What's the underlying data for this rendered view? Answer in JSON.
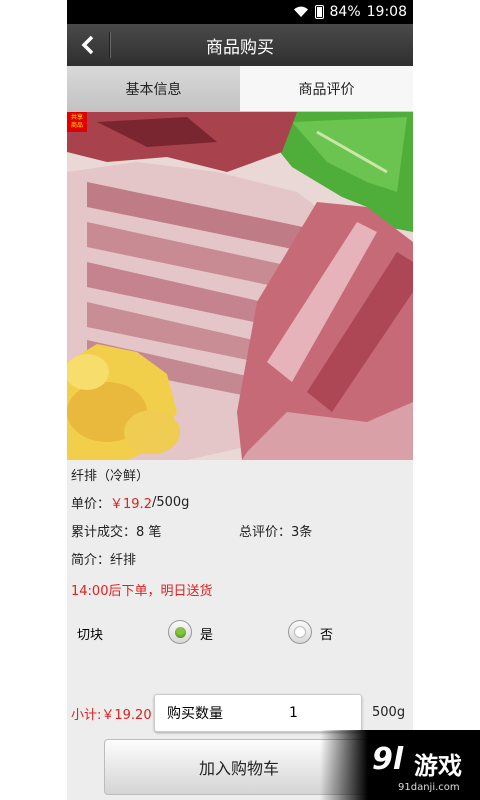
{
  "status": {
    "battery": "84%",
    "time": "19:08"
  },
  "header": {
    "title": "商品购买"
  },
  "tabs": [
    {
      "label": "基本信息"
    },
    {
      "label": "商品评价"
    }
  ],
  "badge": {
    "line1": "共享",
    "line2": "商品"
  },
  "product": {
    "name": "纤排（冷鲜）",
    "price_label": "单价：",
    "price_value": "￥19.2",
    "price_unit": "/500g",
    "sales_label": "累计成交：8 笔",
    "rating_label": "总评价：3条",
    "intro": "简介：纤排",
    "delivery_note": "14:00后下单，明日送货"
  },
  "options": {
    "label": "切块",
    "yes": "是",
    "no": "否",
    "selected": "是"
  },
  "purchase": {
    "subtotal": "小计:￥19.20",
    "qty_label": "购买数量",
    "qty_value": "1",
    "unit": "500g"
  },
  "cart_button": "加入购物车",
  "watermark": {
    "logo": "9l",
    "text": "游戏",
    "url": "91danji.com"
  },
  "colors": {
    "accent_red": "#e02020",
    "radio_selected": "#86c43c",
    "header_bg": "#3c3c3c"
  }
}
